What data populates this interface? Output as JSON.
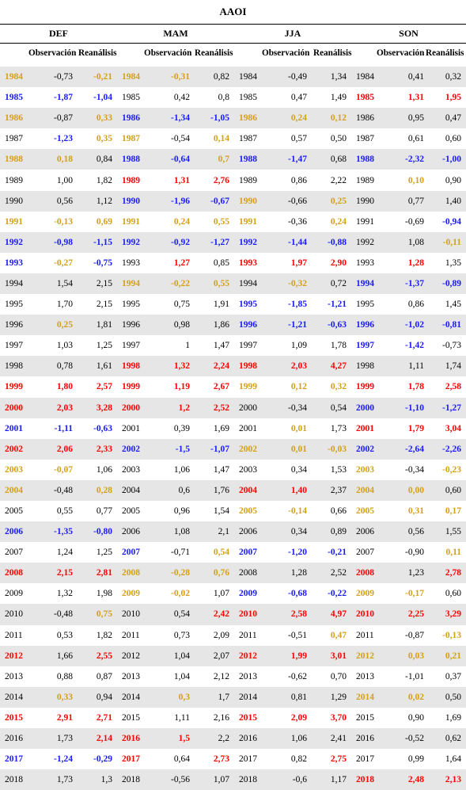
{
  "title": "AAOI",
  "seasons": [
    "DEF",
    "MAM",
    "JJA",
    "SON"
  ],
  "col_obs": "Observación",
  "col_rea": "Reanálisis",
  "colors": {
    "orange": "#d4a017",
    "blue": "#1a1aff",
    "red": "#ff0000",
    "black": "#000000"
  },
  "rows": [
    {
      "def": [
        "1984",
        "-0,73",
        "-0,21",
        "o",
        "",
        "o"
      ],
      "mam": [
        "1984",
        "-0,31",
        "0,82",
        "o",
        "o",
        ""
      ],
      "jja": [
        "1984",
        "-0,49",
        "1,34",
        "",
        "",
        ""
      ],
      "son": [
        "1984",
        "0,41",
        "0,32",
        "",
        "",
        ""
      ]
    },
    {
      "def": [
        "1985",
        "-1,87",
        "-1,04",
        "bb",
        "bb",
        "bb"
      ],
      "mam": [
        "1985",
        "0,42",
        "0,8",
        "",
        "",
        ""
      ],
      "jja": [
        "1985",
        "0,47",
        "1,49",
        "",
        "",
        ""
      ],
      "son": [
        "1985",
        "1,31",
        "1,95",
        "rb",
        "rb",
        "rb"
      ]
    },
    {
      "def": [
        "1986",
        "-0,87",
        "0,33",
        "o",
        "",
        "o"
      ],
      "mam": [
        "1986",
        "-1,34",
        "-1,05",
        "b",
        "bb",
        "bb"
      ],
      "jja": [
        "1986",
        "0,24",
        "0,12",
        "o",
        "o",
        "o"
      ],
      "son": [
        "1986",
        "0,95",
        "0,47",
        "",
        "",
        ""
      ]
    },
    {
      "def": [
        "1987",
        "-1,23",
        "0,35",
        "",
        "b",
        "o"
      ],
      "mam": [
        "1987",
        "-0,54",
        "0,14",
        "o",
        "",
        "o"
      ],
      "jja": [
        "1987",
        "0,57",
        "0,50",
        "",
        "",
        ""
      ],
      "son": [
        "1987",
        "0,61",
        "0,60",
        "",
        "",
        ""
      ]
    },
    {
      "def": [
        "1988",
        "0,18",
        "0,84",
        "o",
        "o",
        ""
      ],
      "mam": [
        "1988",
        "-0,64",
        "0,7",
        "b",
        "b",
        "o"
      ],
      "jja": [
        "1988",
        "-1,47",
        "0,68",
        "b",
        "bb",
        ""
      ],
      "son": [
        "1988",
        "-2,32",
        "-1,00",
        "b",
        "bb",
        "bb"
      ]
    },
    {
      "def": [
        "1989",
        "1,00",
        "1,82",
        "",
        "",
        ""
      ],
      "mam": [
        "1989",
        "1,31",
        "2,76",
        "r",
        "rb",
        "rb"
      ],
      "jja": [
        "1989",
        "0,86",
        "2,22",
        "",
        "",
        ""
      ],
      "son": [
        "1989",
        "0,10",
        "0,90",
        "",
        "o",
        ""
      ]
    },
    {
      "def": [
        "1990",
        "0,56",
        "1,12",
        "",
        "",
        ""
      ],
      "mam": [
        "1990",
        "-1,96",
        "-0,67",
        "b",
        "bb",
        "bb"
      ],
      "jja": [
        "1990",
        "-0,66",
        "0,25",
        "o",
        "",
        "o"
      ],
      "son": [
        "1990",
        "0,77",
        "1,40",
        "",
        "",
        ""
      ]
    },
    {
      "def": [
        "1991",
        "-0,13",
        "0,69",
        "o",
        "o",
        "o"
      ],
      "mam": [
        "1991",
        "0,24",
        "0,55",
        "o",
        "o",
        "o"
      ],
      "jja": [
        "1991",
        "-0,36",
        "0,24",
        "o",
        "",
        "o"
      ],
      "son": [
        "1991",
        "-0,69",
        "-0,94",
        "",
        "",
        "b"
      ]
    },
    {
      "def": [
        "1992",
        "-0,98",
        "-1,15",
        "b",
        "bb",
        "bb"
      ],
      "mam": [
        "1992",
        "-0,92",
        "-1,27",
        "b",
        "bb",
        "bb"
      ],
      "jja": [
        "1992",
        "-1,44",
        "-0,88",
        "b",
        "bb",
        "bb"
      ],
      "son": [
        "1992",
        "1,08",
        "-0,11",
        "",
        "",
        "o"
      ]
    },
    {
      "def": [
        "1993",
        "-0,27",
        "-0,75",
        "b",
        "o",
        "bb"
      ],
      "mam": [
        "1993",
        "1,27",
        "0,85",
        "",
        "r",
        ""
      ],
      "jja": [
        "1993",
        "1,97",
        "2,90",
        "r",
        "rb",
        "rb"
      ],
      "son": [
        "1993",
        "1,28",
        "1,35",
        "",
        "r",
        ""
      ]
    },
    {
      "def": [
        "1994",
        "1,54",
        "2,15",
        "",
        "",
        ""
      ],
      "mam": [
        "1994",
        "-0,22",
        "0,55",
        "o",
        "o",
        "o"
      ],
      "jja": [
        "1994",
        "-0,32",
        "0,72",
        "",
        "o",
        ""
      ],
      "son": [
        "1994",
        "-1,37",
        "-0,89",
        "b",
        "bb",
        "bb"
      ]
    },
    {
      "def": [
        "1995",
        "1,70",
        "2,15",
        "",
        "",
        ""
      ],
      "mam": [
        "1995",
        "0,75",
        "1,91",
        "",
        "",
        ""
      ],
      "jja": [
        "1995",
        "-1,85",
        "-1,21",
        "b",
        "bb",
        "bb"
      ],
      "son": [
        "1995",
        "0,86",
        "1,45",
        "",
        "",
        ""
      ]
    },
    {
      "def": [
        "1996",
        "0,25",
        "1,81",
        "",
        "o",
        ""
      ],
      "mam": [
        "1996",
        "0,98",
        "1,86",
        "",
        "",
        ""
      ],
      "jja": [
        "1996",
        "-1,21",
        "-0,63",
        "b",
        "bb",
        "bb"
      ],
      "son": [
        "1996",
        "-1,02",
        "-0,81",
        "b",
        "bb",
        "bb"
      ]
    },
    {
      "def": [
        "1997",
        "1,03",
        "1,25",
        "",
        "",
        ""
      ],
      "mam": [
        "1997",
        "1",
        "1,47",
        "",
        "",
        ""
      ],
      "jja": [
        "1997",
        "1,09",
        "1,78",
        "",
        "",
        ""
      ],
      "son": [
        "1997",
        "-1,42",
        "-0,73",
        "b",
        "bb",
        ""
      ]
    },
    {
      "def": [
        "1998",
        "0,78",
        "1,61",
        "",
        "",
        ""
      ],
      "mam": [
        "1998",
        "1,32",
        "2,24",
        "r",
        "rb",
        "rb"
      ],
      "jja": [
        "1998",
        "2,03",
        "4,27",
        "r",
        "rb",
        "rb"
      ],
      "son": [
        "1998",
        "1,11",
        "1,74",
        "",
        "",
        ""
      ]
    },
    {
      "def": [
        "1999",
        "1,80",
        "2,57",
        "r",
        "rb",
        "rb"
      ],
      "mam": [
        "1999",
        "1,19",
        "2,67",
        "r",
        "rb",
        "rb"
      ],
      "jja": [
        "1999",
        "0,12",
        "0,32",
        "o",
        "o",
        "o"
      ],
      "son": [
        "1999",
        "1,78",
        "2,58",
        "r",
        "rb",
        "rb"
      ]
    },
    {
      "def": [
        "2000",
        "2,03",
        "3,28",
        "r",
        "rb",
        "rb"
      ],
      "mam": [
        "2000",
        "1,2",
        "2,52",
        "r",
        "rb",
        "rb"
      ],
      "jja": [
        "2000",
        "-0,34",
        "0,54",
        "",
        "",
        ""
      ],
      "son": [
        "2000",
        "-1,10",
        "-1,27",
        "b",
        "bb",
        "bb"
      ]
    },
    {
      "def": [
        "2001",
        "-1,11",
        "-0,63",
        "b",
        "bb",
        "bb"
      ],
      "mam": [
        "2001",
        "0,39",
        "1,69",
        "",
        "",
        ""
      ],
      "jja": [
        "2001",
        "0,01",
        "1,73",
        "",
        "o",
        ""
      ],
      "son": [
        "2001",
        "1,79",
        "3,04",
        "r",
        "rb",
        "rb"
      ]
    },
    {
      "def": [
        "2002",
        "2,06",
        "2,33",
        "r",
        "rb",
        "rb"
      ],
      "mam": [
        "2002",
        "-1,5",
        "-1,07",
        "b",
        "bb",
        "bb"
      ],
      "jja": [
        "2002",
        "0,01",
        "-0,03",
        "o",
        "o",
        "o"
      ],
      "son": [
        "2002",
        "-2,64",
        "-2,26",
        "b",
        "bb",
        "bb"
      ]
    },
    {
      "def": [
        "2003",
        "-0,07",
        "1,06",
        "o",
        "o",
        ""
      ],
      "mam": [
        "2003",
        "1,06",
        "1,47",
        "",
        "",
        ""
      ],
      "jja": [
        "2003",
        "0,34",
        "1,53",
        "",
        "",
        ""
      ],
      "son": [
        "2003",
        "-0,34",
        "-0,23",
        "o",
        "",
        "o"
      ]
    },
    {
      "def": [
        "2004",
        "-0,48",
        "0,28",
        "o",
        "",
        "o"
      ],
      "mam": [
        "2004",
        "0,6",
        "1,76",
        "",
        "",
        ""
      ],
      "jja": [
        "2004",
        "1,40",
        "2,37",
        "r",
        "rb",
        ""
      ],
      "son": [
        "2004",
        "0,00",
        "0,60",
        "o",
        "o",
        ""
      ]
    },
    {
      "def": [
        "2005",
        "0,55",
        "0,77",
        "",
        "",
        ""
      ],
      "mam": [
        "2005",
        "0,96",
        "1,54",
        "",
        "",
        ""
      ],
      "jja": [
        "2005",
        "-0,14",
        "0,66",
        "o",
        "o",
        ""
      ],
      "son": [
        "2005",
        "0,31",
        "0,17",
        "o",
        "o",
        "o"
      ]
    },
    {
      "def": [
        "2006",
        "-1,35",
        "-0,80",
        "b",
        "bb",
        "bb"
      ],
      "mam": [
        "2006",
        "1,08",
        "2,1",
        "",
        "",
        ""
      ],
      "jja": [
        "2006",
        "0,34",
        "0,89",
        "",
        "",
        ""
      ],
      "son": [
        "2006",
        "0,56",
        "1,55",
        "",
        "",
        ""
      ]
    },
    {
      "def": [
        "2007",
        "1,24",
        "1,25",
        "",
        "",
        ""
      ],
      "mam": [
        "2007",
        "-0,71",
        "0,54",
        "b",
        "",
        "o"
      ],
      "jja": [
        "2007",
        "-1,20",
        "-0,21",
        "b",
        "bb",
        "bb"
      ],
      "son": [
        "2007",
        "-0,90",
        "0,11",
        "",
        "",
        "o"
      ]
    },
    {
      "def": [
        "2008",
        "2,15",
        "2,81",
        "r",
        "rb",
        "rb"
      ],
      "mam": [
        "2008",
        "-0,28",
        "0,76",
        "o",
        "o",
        "o"
      ],
      "jja": [
        "2008",
        "1,28",
        "2,52",
        "",
        "",
        ""
      ],
      "son": [
        "2008",
        "1,23",
        "2,78",
        "r",
        "",
        "rb"
      ]
    },
    {
      "def": [
        "2009",
        "1,32",
        "1,98",
        "",
        "",
        ""
      ],
      "mam": [
        "2009",
        "-0,02",
        "1,07",
        "o",
        "o",
        ""
      ],
      "jja": [
        "2009",
        "-0,68",
        "-0,22",
        "b",
        "bb",
        "bb"
      ],
      "son": [
        "2009",
        "-0,17",
        "0,60",
        "o",
        "o",
        ""
      ]
    },
    {
      "def": [
        "2010",
        "-0,48",
        "0,75",
        "",
        "",
        "o"
      ],
      "mam": [
        "2010",
        "0,54",
        "2,42",
        "",
        "",
        "r"
      ],
      "jja": [
        "2010",
        "2,58",
        "4,97",
        "r",
        "rb",
        "rb"
      ],
      "son": [
        "2010",
        "2,25",
        "3,29",
        "r",
        "rb",
        "rb"
      ]
    },
    {
      "def": [
        "2011",
        "0,53",
        "1,82",
        "",
        "",
        ""
      ],
      "mam": [
        "2011",
        "0,73",
        "2,09",
        "",
        "",
        ""
      ],
      "jja": [
        "2011",
        "-0,51",
        "0,47",
        "",
        "",
        "o"
      ],
      "son": [
        "2011",
        "-0,87",
        "-0,13",
        "",
        "",
        "o"
      ]
    },
    {
      "def": [
        "2012",
        "1,66",
        "2,55",
        "r",
        "",
        "r"
      ],
      "mam": [
        "2012",
        "1,04",
        "2,07",
        "",
        "",
        ""
      ],
      "jja": [
        "2012",
        "1,99",
        "3,01",
        "r",
        "rb",
        "rb"
      ],
      "son": [
        "2012",
        "0,03",
        "0,21",
        "o",
        "o",
        "o"
      ]
    },
    {
      "def": [
        "2013",
        "0,88",
        "0,87",
        "",
        "",
        ""
      ],
      "mam": [
        "2013",
        "1,04",
        "2,12",
        "",
        "",
        ""
      ],
      "jja": [
        "2013",
        "-0,62",
        "0,70",
        "",
        "",
        ""
      ],
      "son": [
        "2013",
        "-1,01",
        "0,37",
        "",
        "",
        ""
      ]
    },
    {
      "def": [
        "2014",
        "0,33",
        "0,94",
        "",
        "o",
        ""
      ],
      "mam": [
        "2014",
        "0,3",
        "1,7",
        "",
        "o",
        ""
      ],
      "jja": [
        "2014",
        "0,81",
        "1,29",
        "",
        "",
        ""
      ],
      "son": [
        "2014",
        "0,02",
        "0,50",
        "o",
        "o",
        ""
      ]
    },
    {
      "def": [
        "2015",
        "2,91",
        "2,71",
        "r",
        "rb",
        "r"
      ],
      "mam": [
        "2015",
        "1,11",
        "2,16",
        "",
        "",
        ""
      ],
      "jja": [
        "2015",
        "2,09",
        "3,70",
        "r",
        "rb",
        "rb"
      ],
      "son": [
        "2015",
        "0,90",
        "1,69",
        "",
        "",
        ""
      ]
    },
    {
      "def": [
        "2016",
        "1,73",
        "2,14",
        "",
        "",
        "r"
      ],
      "mam": [
        "2016",
        "1,5",
        "2,2",
        "r",
        "rb",
        ""
      ],
      "jja": [
        "2016",
        "1,06",
        "2,41",
        "",
        "",
        ""
      ],
      "son": [
        "2016",
        "-0,52",
        "0,62",
        "",
        "",
        ""
      ]
    },
    {
      "def": [
        "2017",
        "-1,24",
        "-0,29",
        "b",
        "b",
        "b"
      ],
      "mam": [
        "2017",
        "0,64",
        "2,73",
        "r",
        "",
        "r"
      ],
      "jja": [
        "2017",
        "0,82",
        "2,75",
        "",
        "",
        "r"
      ],
      "son": [
        "2017",
        "0,99",
        "1,64",
        "",
        "",
        ""
      ]
    },
    {
      "def": [
        "2018",
        "1,73",
        "1,3",
        "",
        "",
        ""
      ],
      "mam": [
        "2018",
        "-0,56",
        "1,07",
        "",
        "",
        ""
      ],
      "jja": [
        "2018",
        "-0,6",
        "1,17",
        "",
        "",
        ""
      ],
      "son": [
        "2018",
        "2,48",
        "2,13",
        "r",
        "rb",
        "rb"
      ]
    }
  ]
}
